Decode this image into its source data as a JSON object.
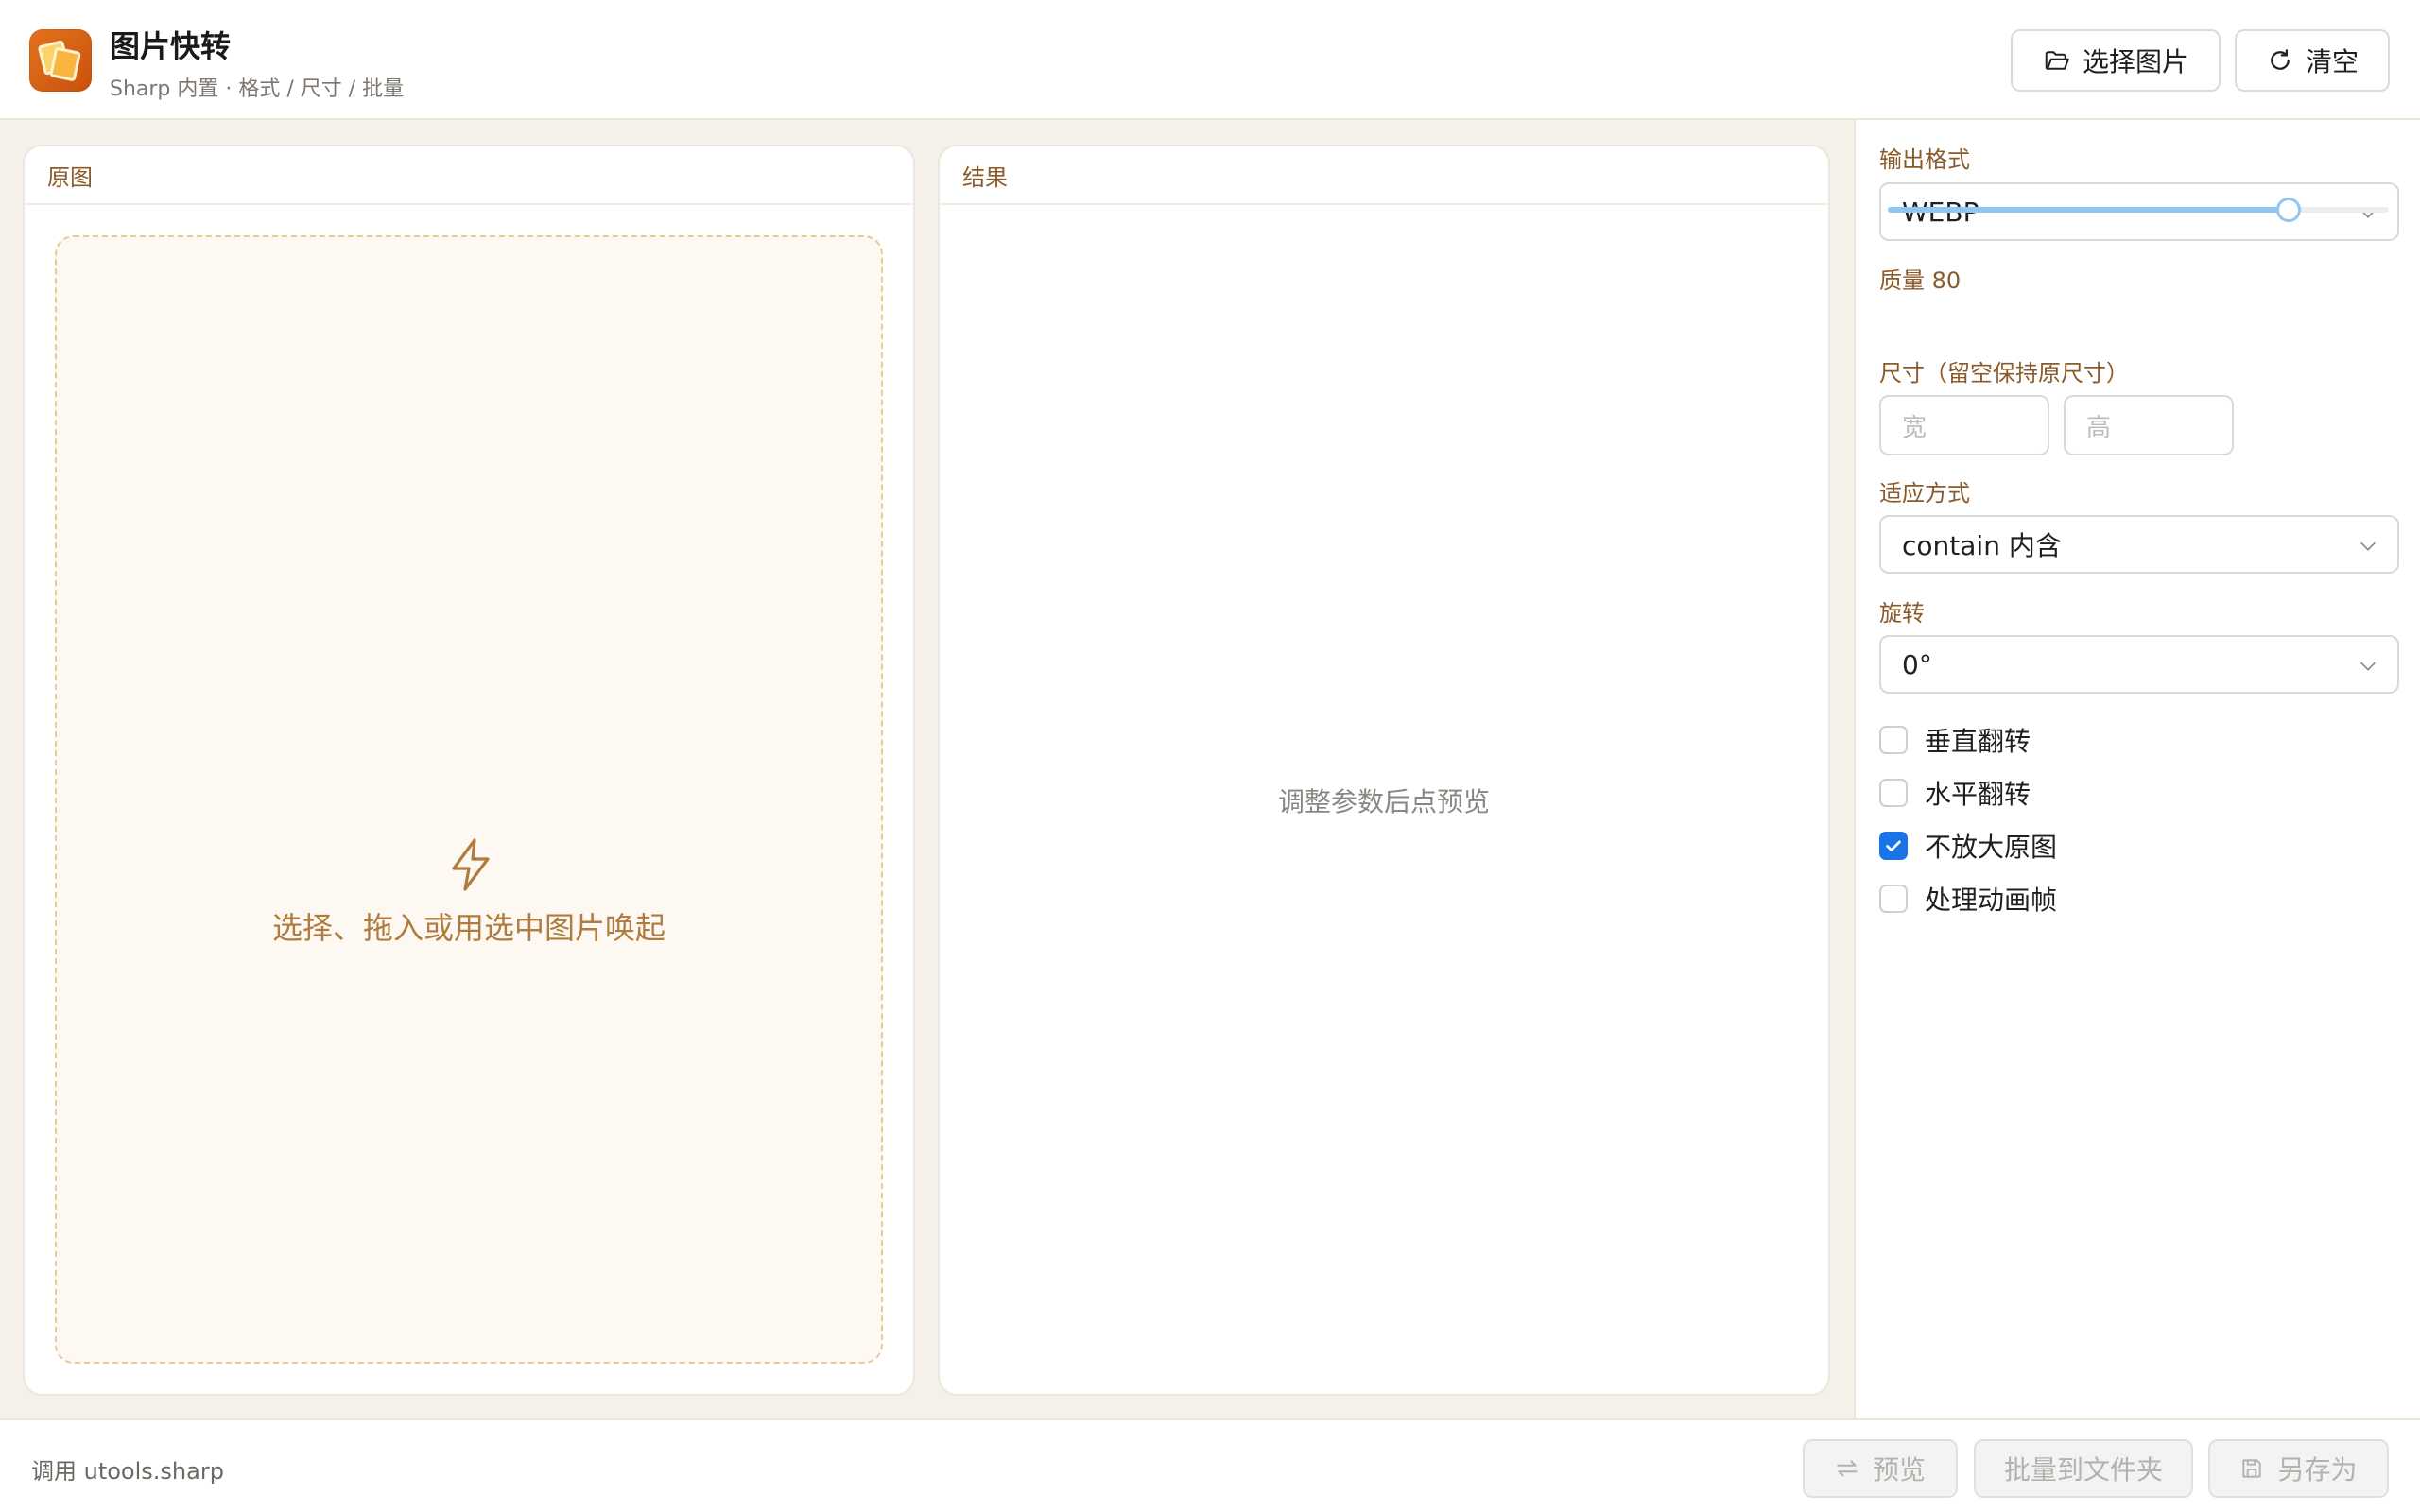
{
  "app": {
    "title": "图片快转",
    "subtitle": "Sharp 内置 · 格式 / 尺寸 / 批量",
    "icon": "app-images-icon"
  },
  "header_buttons": {
    "select_label": "选择图片",
    "select_icon": "folder-open-icon",
    "clear_label": "清空",
    "clear_icon": "refresh-icon"
  },
  "panels": {
    "original_title": "原图",
    "result_title": "结果",
    "drop_text": "选择、拖入或用选中图片唤起",
    "drop_icon": "lightning-icon",
    "result_placeholder": "调整参数后点预览"
  },
  "settings": {
    "format_label": "输出格式",
    "format_value": "WEBP",
    "quality_label": "质量 80",
    "quality_value": 80,
    "quality_max": 100,
    "size_label": "尺寸（留空保持原尺寸）",
    "width_placeholder": "宽",
    "height_placeholder": "高",
    "fit_label": "适应方式",
    "fit_value": "contain 内含",
    "rotate_label": "旋转",
    "rotate_value": "0°",
    "checkboxes": [
      {
        "label": "垂直翻转",
        "checked": false
      },
      {
        "label": "水平翻转",
        "checked": false
      },
      {
        "label": "不放大原图",
        "checked": true
      },
      {
        "label": "处理动画帧",
        "checked": false
      }
    ]
  },
  "footer": {
    "status": "调用 utools.sharp",
    "preview_label": "预览",
    "preview_icon": "swap-arrows-icon",
    "batch_label": "批量到文件夹",
    "saveas_label": "另存为",
    "saveas_icon": "save-disk-icon"
  },
  "colors": {
    "accent_brown": "#8b5a2b",
    "checkbox_blue": "#1b73e8",
    "slider_blue": "#8fc6f4",
    "app_icon_orange": "#d9621a"
  }
}
